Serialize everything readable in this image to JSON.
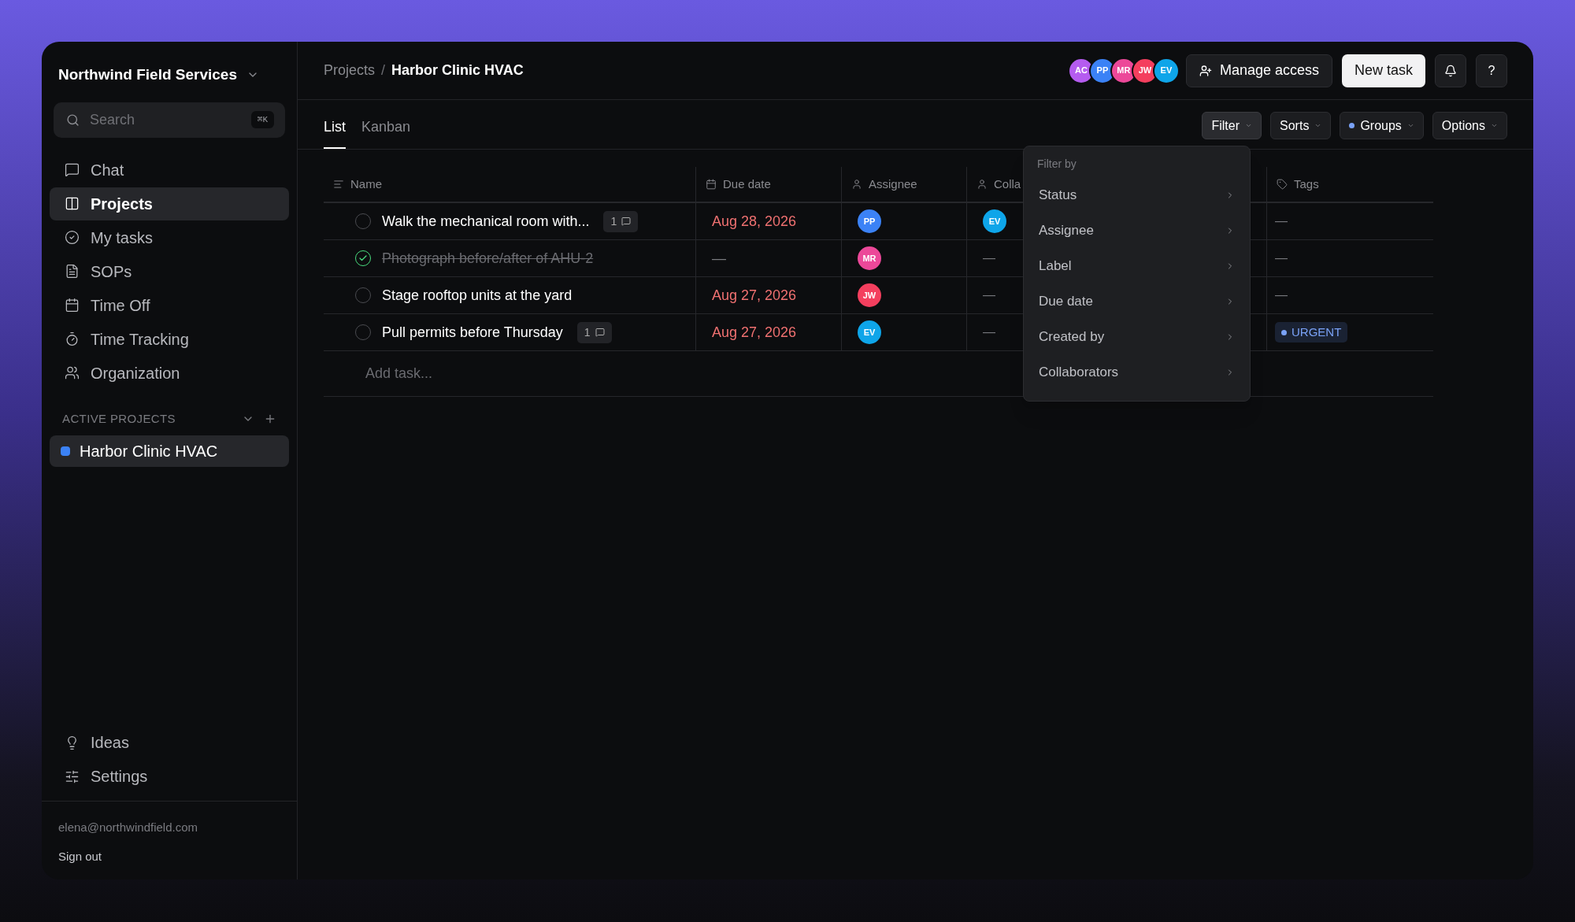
{
  "workspace": {
    "name": "Northwind Field Services"
  },
  "search": {
    "placeholder": "Search",
    "shortcut": "⌘K"
  },
  "nav": [
    {
      "label": "Chat",
      "selected": false
    },
    {
      "label": "Projects",
      "selected": true
    },
    {
      "label": "My tasks",
      "selected": false
    },
    {
      "label": "SOPs",
      "selected": false
    },
    {
      "label": "Time Off",
      "selected": false
    },
    {
      "label": "Time Tracking",
      "selected": false
    },
    {
      "label": "Organization",
      "selected": false
    }
  ],
  "projects_section": {
    "title": "ACTIVE PROJECTS"
  },
  "projects": [
    {
      "name": "Harbor Clinic HVAC",
      "color": "#3b82f6",
      "selected": true
    }
  ],
  "footer_nav": [
    {
      "label": "Ideas"
    },
    {
      "label": "Settings"
    }
  ],
  "user": {
    "email": "elena@northwindfield.com",
    "sign_out": "Sign out"
  },
  "breadcrumb": {
    "parent": "Projects",
    "separator": "/",
    "current": "Harbor Clinic HVAC"
  },
  "members": [
    {
      "initials": "AC",
      "color": "#b55cf0"
    },
    {
      "initials": "PP",
      "color": "#3b82f6"
    },
    {
      "initials": "MR",
      "color": "#ec4899"
    },
    {
      "initials": "JW",
      "color": "#f43f5e"
    },
    {
      "initials": "EV",
      "color": "#0ea5e9"
    }
  ],
  "header_buttons": {
    "manage": "Manage access",
    "new_task": "New task",
    "help": "?"
  },
  "view_tabs": [
    {
      "label": "List",
      "selected": true
    },
    {
      "label": "Kanban",
      "selected": false
    }
  ],
  "toolbar": [
    {
      "label": "Filter",
      "selected": true
    },
    {
      "label": "Sorts",
      "selected": false
    },
    {
      "label": "Groups",
      "selected": false,
      "color": "#7aa2f7"
    },
    {
      "label": "Options",
      "selected": false
    }
  ],
  "table": {
    "columns": [
      {
        "label": "Name"
      },
      {
        "label": "Due date"
      },
      {
        "label": "Assignee"
      },
      {
        "label": "Colla"
      },
      {
        "label": "Tags"
      }
    ],
    "rows": [
      {
        "name": "Walk the mechanical room with...",
        "done": false,
        "comments": "1",
        "due": "Aug 28, 2026",
        "assignee": {
          "initials": "PP",
          "color": "#3b82f6"
        },
        "collaborator": {
          "initials": "EV",
          "color": "#0ea5e9"
        },
        "tags": [],
        "empty": "—"
      },
      {
        "name": "Photograph before/after of AHU-2",
        "done": true,
        "due": "—",
        "assignee": {
          "initials": "MR",
          "color": "#ec4899"
        },
        "tags": [],
        "empty": "—"
      },
      {
        "name": "Stage rooftop units at the yard",
        "done": false,
        "due": "Aug 27, 2026",
        "assignee": {
          "initials": "JW",
          "color": "#f43f5e"
        },
        "tags": [],
        "empty": "—"
      },
      {
        "name": "Pull permits before Thursday",
        "done": false,
        "comments": "1",
        "due": "Aug 27, 2026",
        "assignee": {
          "initials": "EV",
          "color": "#0ea5e9"
        },
        "tags": [
          {
            "label": "URGENT",
            "color": "#7aa2f7"
          }
        ],
        "empty": "—"
      }
    ],
    "add_placeholder": "Add task..."
  },
  "filter_menu": {
    "title": "Filter by",
    "items": [
      "Status",
      "Assignee",
      "Label",
      "Due date",
      "Created by",
      "Collaborators"
    ]
  }
}
